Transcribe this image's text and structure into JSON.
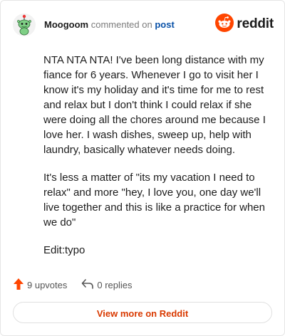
{
  "comment": {
    "username": "Moogoom",
    "action": "commented on",
    "target": "post",
    "paragraphs": [
      "NTA NTA NTA! I've been long distance with my fiance for 6 years. Whenever I go to visit her I know it's my holiday and it's time for me to rest and relax but I don't think I could relax if she were doing all the chores around me because I love her. I wash dishes, sweep up, help with laundry, basically whatever needs doing.",
      "It's less a matter of \"its my vacation I need to relax\" and more \"hey, I love you, one day we'll live together and this is like a practice for when we do\"",
      "Edit:typo"
    ],
    "upvotes": "9 upvotes",
    "replies": "0 replies"
  },
  "brand": {
    "wordmark": "reddit",
    "color": "#ff4500"
  },
  "icons": {
    "avatar": "snoo-avatar-icon",
    "logo": "reddit-logo-icon",
    "upvote": "upvote-arrow-icon",
    "reply": "reply-arrow-icon"
  },
  "colors": {
    "upvote": "#ff4500",
    "link": "#0a52a8",
    "cta": "#d93900"
  },
  "cta": {
    "label": "View more on Reddit"
  }
}
